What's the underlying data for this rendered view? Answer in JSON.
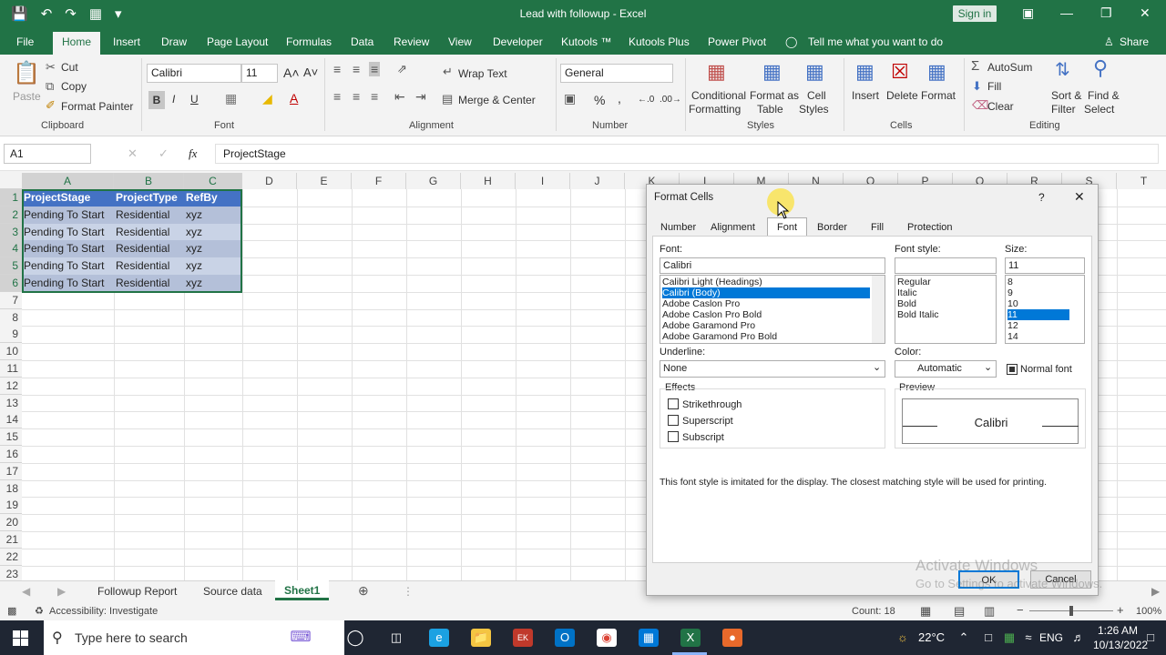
{
  "app": {
    "title": "Lead with followup  -  Excel",
    "signin": "Sign in"
  },
  "ribbon_tabs": [
    "File",
    "Home",
    "Insert",
    "Draw",
    "Page Layout",
    "Formulas",
    "Data",
    "Review",
    "View",
    "Developer",
    "Kutools ™",
    "Kutools Plus",
    "Power Pivot",
    "Tell me what you want to do"
  ],
  "share_label": "Share",
  "clipboard": {
    "paste": "Paste",
    "cut": "Cut",
    "copy": "Copy",
    "format_painter": "Format Painter",
    "group": "Clipboard"
  },
  "font_group": {
    "font_name": "Calibri",
    "font_size": "11",
    "bold": "B",
    "italic": "I",
    "underline": "U",
    "group": "Font"
  },
  "alignment": {
    "wrap_text": "Wrap Text",
    "merge_center": "Merge & Center",
    "group": "Alignment"
  },
  "number": {
    "format": "General",
    "percent": "%",
    "comma": ",",
    "group": "Number"
  },
  "styles": {
    "conditional": "Conditional",
    "conditional2": "Formatting",
    "format_as": "Format as",
    "format_as2": "Table",
    "cell": "Cell",
    "cell2": "Styles",
    "group": "Styles"
  },
  "cells_group": {
    "insert": "Insert",
    "delete": "Delete",
    "format": "Format",
    "group": "Cells"
  },
  "editing": {
    "autosum": "AutoSum",
    "fill": "Fill",
    "clear": "Clear",
    "sort": "Sort &",
    "sort2": "Filter",
    "find": "Find &",
    "find2": "Select",
    "group": "Editing"
  },
  "formula_bar": {
    "namebox": "A1",
    "fx": "fx",
    "content": "ProjectStage"
  },
  "columns": [
    "A",
    "B",
    "C",
    "D",
    "E",
    "F",
    "G",
    "H",
    "I",
    "J",
    "K",
    "L",
    "M",
    "N",
    "O",
    "P",
    "Q",
    "R",
    "S",
    "T"
  ],
  "rows": [
    "1",
    "2",
    "3",
    "4",
    "5",
    "6",
    "7",
    "8",
    "9",
    "10",
    "11",
    "12",
    "13",
    "14",
    "15",
    "16",
    "17",
    "18",
    "19",
    "20",
    "21",
    "22",
    "23"
  ],
  "sheet": {
    "header": [
      "ProjectStage",
      "ProjectType",
      "RefBy"
    ],
    "data": [
      [
        "Pending To Start",
        "Residential",
        "xyz"
      ],
      [
        "Pending To Start",
        "Residential",
        "xyz"
      ],
      [
        "Pending To Start",
        "Residential",
        "xyz"
      ],
      [
        "Pending To Start",
        "Residential",
        "xyz"
      ],
      [
        "Pending To Start",
        "Residential",
        "xyz"
      ]
    ]
  },
  "sheet_tabs": [
    "Followup Report",
    "Source data",
    "Sheet1"
  ],
  "active_sheet": "Sheet1",
  "status": {
    "accessibility": "Accessibility: Investigate",
    "count": "Count: 18",
    "zoom": "100%"
  },
  "taskbar": {
    "search": "Type here to search",
    "weather": "22°C",
    "lang": "ENG",
    "time": "1:26 AM",
    "date": "10/13/2022"
  },
  "dialog": {
    "title": "Format Cells",
    "help": "?",
    "tabs": [
      "Number",
      "Alignment",
      "Font",
      "Border",
      "Fill",
      "Protection"
    ],
    "active_tab": "Font",
    "font_label": "Font:",
    "font_value": "Calibri",
    "fonts": [
      "Calibri Light (Headings)",
      "Calibri (Body)",
      "Adobe Caslon Pro",
      "Adobe Caslon Pro Bold",
      "Adobe Garamond Pro",
      "Adobe Garamond Pro Bold"
    ],
    "style_label": "Font style:",
    "styles": [
      "Regular",
      "Italic",
      "Bold",
      "Bold Italic"
    ],
    "size_label": "Size:",
    "size_value": "11",
    "sizes": [
      "8",
      "9",
      "10",
      "11",
      "12",
      "14"
    ],
    "underline_label": "Underline:",
    "underline_value": "None",
    "color_label": "Color:",
    "color_value": "Automatic",
    "normal_font": "Normal font",
    "effects_label": "Effects",
    "effects": [
      "Strikethrough",
      "Superscript",
      "Subscript"
    ],
    "preview_label": "Preview",
    "preview_text": "Calibri",
    "note": "This font style is imitated for the display.  The closest matching style will be used for printing.",
    "ok": "OK",
    "cancel": "Cancel"
  },
  "watermark": {
    "line1": "Activate Windows",
    "line2": "Go to Settings to activate Windows."
  },
  "colors": {
    "excel_green": "#217346",
    "header_fill": "#4472c4",
    "band_fill": "#d9e1f2",
    "selected": "#0078d7"
  }
}
